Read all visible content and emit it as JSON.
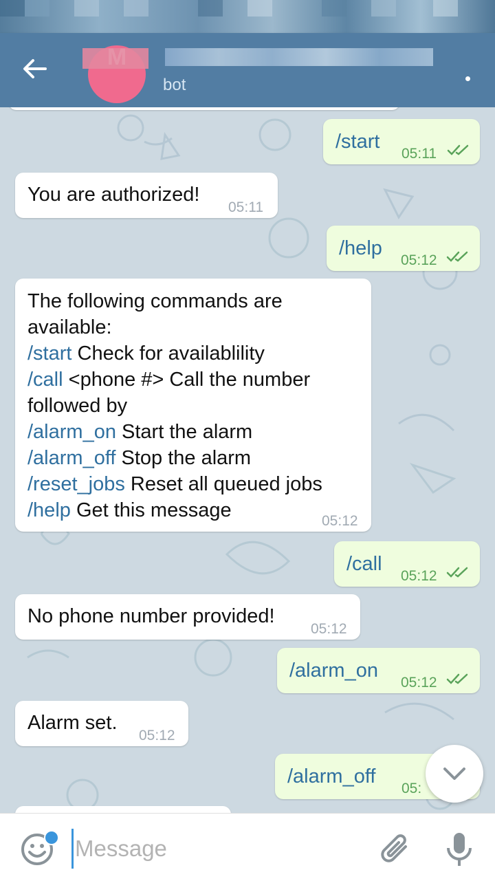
{
  "header": {
    "subtitle": "bot",
    "avatar_letter": "M"
  },
  "messages": [
    {
      "dir": "out",
      "text": "/start",
      "time": "05:11"
    },
    {
      "dir": "in",
      "text": "You are authorized!",
      "time": "05:11"
    },
    {
      "dir": "out",
      "text": "/help",
      "time": "05:12"
    },
    {
      "dir": "in",
      "time": "05:12",
      "lines": [
        {
          "plain": "The following commands are"
        },
        {
          "plain": "available:"
        },
        {
          "cmd": "/start",
          "rest": " Check for availablility"
        },
        {
          "cmd": "/call",
          "rest": " <phone #> Call the number"
        },
        {
          "plain": "followed by"
        },
        {
          "cmd": "/alarm_on",
          "rest": " Start the alarm"
        },
        {
          "cmd": "/alarm_off",
          "rest": " Stop the alarm"
        },
        {
          "cmd": "/reset_jobs",
          "rest": " Reset all queued jobs"
        },
        {
          "cmd": "/help",
          "rest": " Get this message"
        }
      ]
    },
    {
      "dir": "out",
      "text": "/call",
      "time": "05:12"
    },
    {
      "dir": "in",
      "text": "No phone number provided!",
      "time": "05:12"
    },
    {
      "dir": "out",
      "text": "/alarm_on",
      "time": "05:12"
    },
    {
      "dir": "in",
      "text": "Alarm set.",
      "time": "05:12"
    },
    {
      "dir": "out",
      "text": "/alarm_off",
      "time": "05:"
    }
  ],
  "input": {
    "placeholder": "Message"
  },
  "icons": {
    "back": "arrow-back-icon",
    "menu": "more-vert-icon",
    "scroll": "chevron-down-icon",
    "emoji": "emoji-icon",
    "attach": "paperclip-icon",
    "mic": "microphone-icon",
    "read": "double-check-icon"
  },
  "colors": {
    "header": "#527da3",
    "outgoing_bubble": "#effdde",
    "incoming_bubble": "#ffffff",
    "command_link": "#2f6f9f",
    "read_check": "#5aa35a",
    "avatar": "#f06a8e",
    "accent": "#3a95dc"
  }
}
